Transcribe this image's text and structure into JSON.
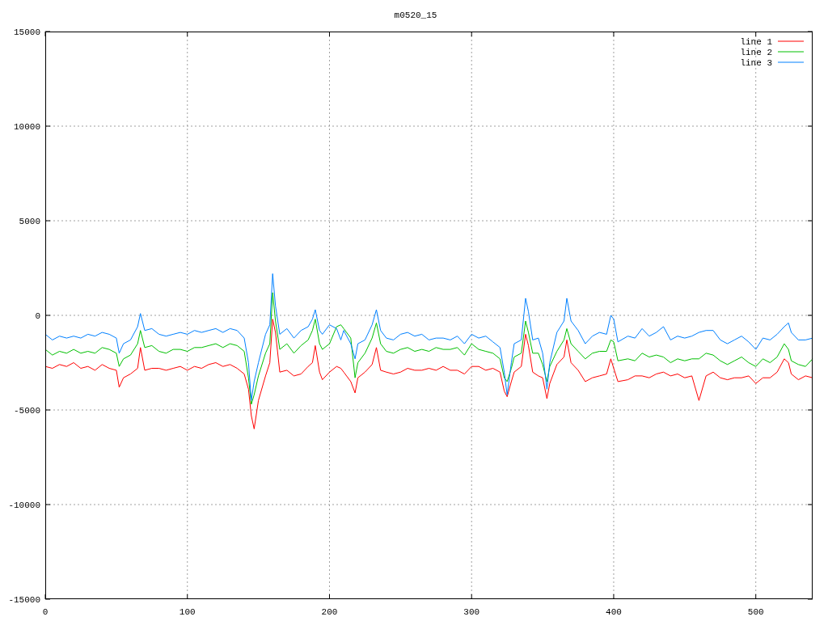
{
  "chart_data": {
    "type": "line",
    "title": "m0520_15",
    "x": [
      0,
      5,
      10,
      15,
      20,
      25,
      30,
      35,
      40,
      45,
      50,
      52,
      55,
      60,
      65,
      67,
      70,
      75,
      80,
      85,
      90,
      95,
      100,
      105,
      110,
      115,
      120,
      125,
      130,
      135,
      140,
      143,
      145,
      147,
      150,
      155,
      158,
      160,
      162,
      165,
      170,
      175,
      180,
      185,
      188,
      190,
      193,
      195,
      200,
      205,
      208,
      210,
      215,
      218,
      220,
      225,
      230,
      233,
      236,
      240,
      245,
      250,
      255,
      260,
      265,
      270,
      275,
      280,
      285,
      290,
      295,
      300,
      305,
      310,
      315,
      320,
      323,
      325,
      328,
      330,
      335,
      338,
      340,
      343,
      347,
      350,
      353,
      355,
      360,
      365,
      367,
      370,
      375,
      380,
      385,
      390,
      395,
      398,
      400,
      403,
      410,
      415,
      420,
      425,
      430,
      435,
      440,
      445,
      450,
      455,
      460,
      465,
      470,
      475,
      480,
      485,
      490,
      495,
      500,
      505,
      510,
      515,
      520,
      523,
      525,
      530,
      535,
      540
    ],
    "series": [
      {
        "name": "line 1",
        "color": "#ff0000",
        "values": [
          -2700,
          -2800,
          -2600,
          -2700,
          -2500,
          -2800,
          -2700,
          -2900,
          -2600,
          -2800,
          -2900,
          -3800,
          -3300,
          -3100,
          -2800,
          -1700,
          -2900,
          -2800,
          -2800,
          -2900,
          -2800,
          -2700,
          -2900,
          -2700,
          -2800,
          -2600,
          -2500,
          -2700,
          -2600,
          -2800,
          -3100,
          -3900,
          -5300,
          -6000,
          -4500,
          -3200,
          -2500,
          -200,
          -900,
          -3000,
          -2900,
          -3200,
          -3100,
          -2700,
          -2500,
          -1600,
          -3000,
          -3400,
          -3000,
          -2700,
          -2800,
          -3000,
          -3500,
          -4100,
          -3300,
          -3000,
          -2600,
          -1700,
          -2900,
          -3000,
          -3100,
          -3000,
          -2800,
          -2900,
          -2900,
          -2800,
          -2900,
          -2700,
          -2900,
          -2900,
          -3100,
          -2700,
          -2700,
          -2900,
          -2800,
          -3000,
          -4000,
          -4300,
          -3500,
          -3000,
          -2700,
          -1000,
          -1600,
          -3000,
          -3200,
          -3300,
          -4400,
          -3600,
          -2600,
          -2200,
          -1300,
          -2500,
          -2900,
          -3500,
          -3300,
          -3200,
          -3100,
          -2300,
          -2800,
          -3500,
          -3400,
          -3200,
          -3200,
          -3300,
          -3100,
          -3000,
          -3200,
          -3100,
          -3300,
          -3200,
          -4500,
          -3200,
          -3000,
          -3300,
          -3400,
          -3300,
          -3300,
          -3200,
          -3600,
          -3300,
          -3300,
          -3000,
          -2300,
          -2500,
          -3100,
          -3400,
          -3200,
          -3300
        ]
      },
      {
        "name": "line 2",
        "color": "#00c000",
        "values": [
          -1800,
          -2100,
          -1900,
          -2000,
          -1800,
          -2000,
          -1900,
          -2000,
          -1700,
          -1800,
          -2000,
          -2700,
          -2300,
          -2100,
          -1500,
          -800,
          -1700,
          -1600,
          -1900,
          -2000,
          -1800,
          -1800,
          -1900,
          -1700,
          -1700,
          -1600,
          -1500,
          -1700,
          -1500,
          -1600,
          -1900,
          -3300,
          -4700,
          -4200,
          -3200,
          -2000,
          -1500,
          1200,
          -300,
          -1800,
          -1500,
          -2000,
          -1600,
          -1300,
          -800,
          -200,
          -1500,
          -1800,
          -1500,
          -600,
          -500,
          -700,
          -1200,
          -3300,
          -2500,
          -2000,
          -1200,
          -400,
          -1500,
          -1900,
          -2000,
          -1800,
          -1700,
          -1900,
          -1800,
          -1900,
          -1700,
          -1800,
          -1800,
          -1700,
          -2100,
          -1500,
          -1800,
          -1900,
          -2000,
          -2300,
          -3300,
          -3500,
          -2800,
          -2200,
          -2000,
          -300,
          -900,
          -2000,
          -2000,
          -2600,
          -3500,
          -2700,
          -1900,
          -1300,
          -700,
          -1500,
          -1900,
          -2300,
          -2000,
          -1900,
          -1900,
          -1300,
          -1400,
          -2400,
          -2300,
          -2400,
          -2000,
          -2200,
          -2100,
          -2200,
          -2500,
          -2300,
          -2400,
          -2300,
          -2300,
          -2000,
          -2100,
          -2400,
          -2600,
          -2400,
          -2200,
          -2500,
          -2700,
          -2300,
          -2500,
          -2200,
          -1500,
          -1800,
          -2400,
          -2600,
          -2700,
          -2300
        ]
      },
      {
        "name": "line 3",
        "color": "#0080ff",
        "values": [
          -1000,
          -1300,
          -1100,
          -1200,
          -1100,
          -1200,
          -1000,
          -1100,
          -900,
          -1000,
          -1200,
          -2000,
          -1500,
          -1300,
          -600,
          100,
          -800,
          -700,
          -1000,
          -1100,
          -1000,
          -900,
          -1000,
          -800,
          -900,
          -800,
          -700,
          -900,
          -700,
          -800,
          -1200,
          -2500,
          -4500,
          -3500,
          -2500,
          -1000,
          -500,
          2200,
          500,
          -1000,
          -700,
          -1200,
          -800,
          -600,
          -200,
          300,
          -800,
          -1000,
          -500,
          -700,
          -1300,
          -800,
          -1500,
          -2300,
          -1500,
          -1300,
          -500,
          300,
          -800,
          -1200,
          -1300,
          -1000,
          -900,
          -1100,
          -1000,
          -1300,
          -1200,
          -1200,
          -1300,
          -1100,
          -1500,
          -1000,
          -1200,
          -1100,
          -1400,
          -1700,
          -3000,
          -4200,
          -2500,
          -1500,
          -1300,
          900,
          200,
          -1300,
          -1200,
          -2000,
          -3900,
          -2500,
          -900,
          -300,
          900,
          -300,
          -800,
          -1500,
          -1100,
          -900,
          -1000,
          0,
          -200,
          -1400,
          -1100,
          -1200,
          -700,
          -1100,
          -900,
          -600,
          -1300,
          -1100,
          -1200,
          -1100,
          -900,
          -800,
          -800,
          -1300,
          -1500,
          -1300,
          -1100,
          -1400,
          -1800,
          -1200,
          -1300,
          -1000,
          -600,
          -400,
          -900,
          -1300,
          -1300,
          -1200
        ]
      }
    ],
    "grid": true,
    "legend": true,
    "xlim": [
      0,
      540
    ],
    "ylim": [
      -15000,
      15000
    ],
    "xticks": [
      0,
      100,
      200,
      300,
      400,
      500
    ],
    "yticks": [
      -15000,
      -10000,
      -5000,
      0,
      5000,
      10000,
      15000
    ]
  }
}
